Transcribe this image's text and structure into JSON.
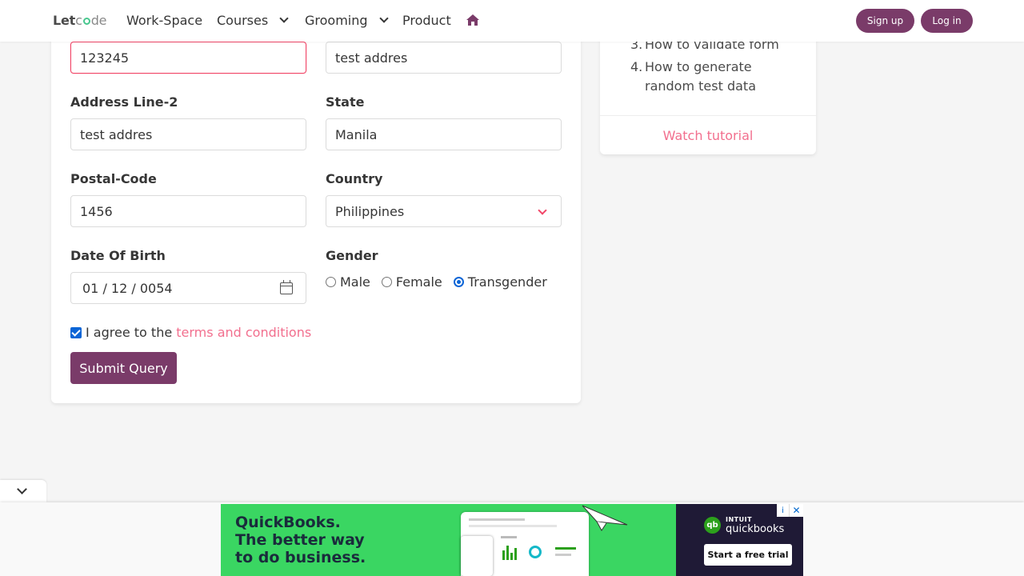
{
  "navbar": {
    "logo": {
      "part1": "Let",
      "part2": "c",
      "part3": "de"
    },
    "items": [
      {
        "label": "Work-Space"
      },
      {
        "label": "Courses"
      },
      {
        "label": "Grooming"
      },
      {
        "label": "Product"
      }
    ],
    "signup_label": "Sign up",
    "login_label": "Log in",
    "accent_color": "#7a3b69"
  },
  "form": {
    "address_line1_partial": {
      "value": "123245"
    },
    "address_line1_right": {
      "value": "test addres"
    },
    "address_line2": {
      "label": "Address Line-2",
      "value": "test addres"
    },
    "state": {
      "label": "State",
      "value": "Manila"
    },
    "postal_code": {
      "label": "Postal-Code",
      "value": "1456"
    },
    "country": {
      "label": "Country",
      "value": "Philippines"
    },
    "dob": {
      "label": "Date Of Birth",
      "value": "01 / 12 / 0054"
    },
    "gender": {
      "label": "Gender",
      "options": [
        {
          "label": "Male",
          "checked": false
        },
        {
          "label": "Female",
          "checked": false
        },
        {
          "label": "Transgender",
          "checked": true
        }
      ]
    },
    "agree": {
      "prefix": "I agree to the ",
      "link": "terms and conditions",
      "checked": true
    },
    "submit_label": "Submit Query"
  },
  "tutorial": {
    "items": [
      {
        "num": "3.",
        "text": "How to validate form"
      },
      {
        "num": "4.",
        "text": "How to generate random test data"
      }
    ],
    "watch_label": "Watch tutorial"
  },
  "ad": {
    "headline": [
      "QuickBooks.",
      "The better way",
      "to do business."
    ],
    "brand_small": "INTUIT",
    "brand": "quickbooks",
    "cta": "Start a free trial",
    "logo_mark": "qb"
  }
}
